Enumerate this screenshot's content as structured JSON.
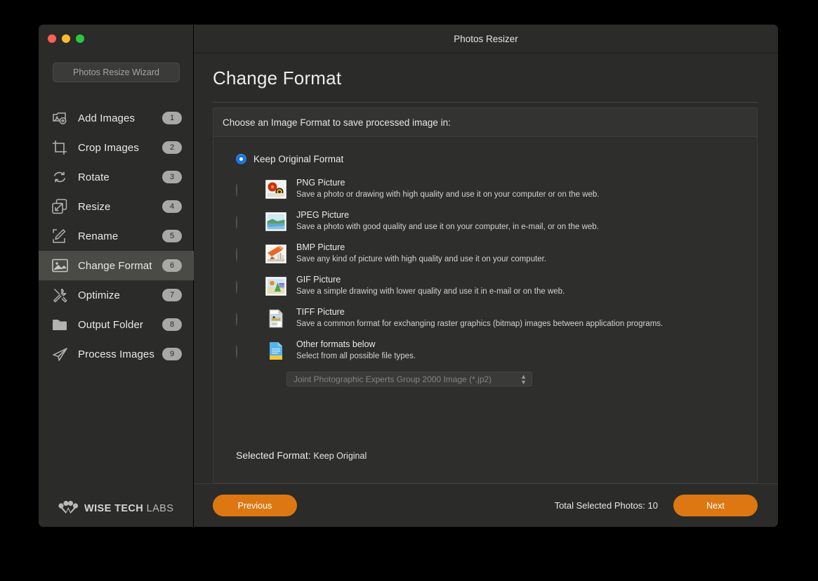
{
  "window": {
    "title": "Photos Resizer",
    "traffic_lights": [
      "close",
      "minimize",
      "maximize"
    ]
  },
  "sidebar": {
    "wizard_button_label": "Photos Resize Wizard",
    "items": [
      {
        "label": "Add Images",
        "badge": "1",
        "icon": "add-images-icon",
        "active": false
      },
      {
        "label": "Crop Images",
        "badge": "2",
        "icon": "crop-icon",
        "active": false
      },
      {
        "label": "Rotate",
        "badge": "3",
        "icon": "rotate-icon",
        "active": false
      },
      {
        "label": "Resize",
        "badge": "4",
        "icon": "resize-icon",
        "active": false
      },
      {
        "label": "Rename",
        "badge": "5",
        "icon": "rename-icon",
        "active": false
      },
      {
        "label": "Change Format",
        "badge": "6",
        "icon": "image-icon",
        "active": true
      },
      {
        "label": "Optimize",
        "badge": "7",
        "icon": "tools-icon",
        "active": false
      },
      {
        "label": "Output Folder",
        "badge": "8",
        "icon": "folder-icon",
        "active": false
      },
      {
        "label": "Process Images",
        "badge": "9",
        "icon": "paper-plane-icon",
        "active": false
      }
    ],
    "brand": {
      "strong": "WISE TECH",
      "light": "LABS"
    }
  },
  "main": {
    "page_title": "Change Format",
    "groupbox_header": "Choose an Image Format to save processed image in:",
    "keep_original": {
      "label": "Keep Original Format",
      "selected": true
    },
    "formats": [
      {
        "title": "PNG Picture",
        "desc": "Save a photo or drawing with high quality and use it on your computer or on the web.",
        "thumb": "png-thumbnail-icon",
        "selected": false
      },
      {
        "title": "JPEG Picture",
        "desc": "Save a photo with good quality and use it on your computer, in e-mail, or on the web.",
        "thumb": "jpeg-thumbnail-icon",
        "selected": false
      },
      {
        "title": "BMP Picture",
        "desc": "Save any kind of picture with high quality and use it on your computer.",
        "thumb": "bmp-thumbnail-icon",
        "selected": false
      },
      {
        "title": "GIF Picture",
        "desc": "Save a simple drawing with lower quality and use it in e-mail or on the web.",
        "thumb": "gif-thumbnail-icon",
        "selected": false
      },
      {
        "title": "TIFF Picture",
        "desc": "Save a common format for exchanging raster graphics (bitmap) images between application programs.",
        "thumb": "tiff-thumbnail-icon",
        "selected": false
      },
      {
        "title": "Other formats below",
        "desc": "Select from all possible file types.",
        "thumb": "generic-document-icon",
        "selected": false
      }
    ],
    "other_dropdown": {
      "value": "Joint Photographic Experts Group 2000 Image (*.jp2)",
      "disabled": true
    },
    "selected_format_label": "Selected Format:",
    "selected_format_value": "Keep Original"
  },
  "footer": {
    "previous_label": "Previous",
    "next_label": "Next",
    "total_photos": "Total Selected Photos: 10"
  },
  "colors": {
    "accent_orange": "#dd7711",
    "radio_blue": "#1a74e2",
    "window_bg": "#2b2b29",
    "panel_bg": "#2e2e2c",
    "active_nav": "#4a4a47"
  }
}
